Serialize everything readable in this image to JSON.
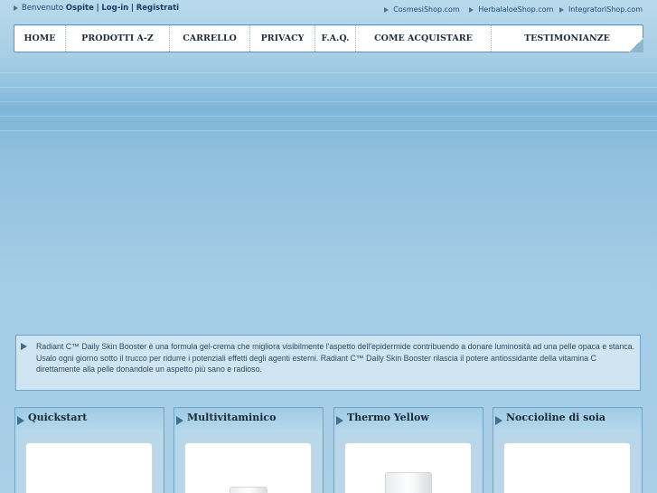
{
  "header": {
    "welcome_prefix": "Benvenuto",
    "welcome_user": "Ospite",
    "login_label": "Log-in",
    "separator": "|",
    "register_label": "Registrati",
    "sites": [
      "CosmesiShop.com",
      "HerbalaloeShop.com",
      "IntegratoriShop.com"
    ]
  },
  "nav": {
    "items": [
      "HOME",
      "PRODOTTI A-Z",
      "CARRELLO",
      "PRIVACY",
      "F.A.Q.",
      "COME ACQUISTARE",
      "TESTIMONIANZE"
    ]
  },
  "description": {
    "text": "Radiant C™ Daily Skin Booster è una formula gel-crema che migliora visibilmente l'aspetto dell'epidermide contribuendo a donare luminosità ad una pelle opaca e stanca. Usalo ogni giorno sotto il trucco per ridurre i potenziali effetti degli agenti esterni. Radiant C™ Daily Skin Booster rilascia il potere antiossidante della vitamina C direttamente alla pelle donandole un aspetto più sano e radioso."
  },
  "products": [
    {
      "title": "Quickstart"
    },
    {
      "title": "Multivitaminico"
    },
    {
      "title": "Thermo Yellow"
    },
    {
      "title": "Noccioline di soia"
    }
  ],
  "colors": {
    "background": "#a3cbe5",
    "nav_background": "#ffffff",
    "card_background": "#b8d7eb",
    "accent_border": "#6fa4c6"
  },
  "icons": {
    "bullet": "triangle-right-icon"
  }
}
